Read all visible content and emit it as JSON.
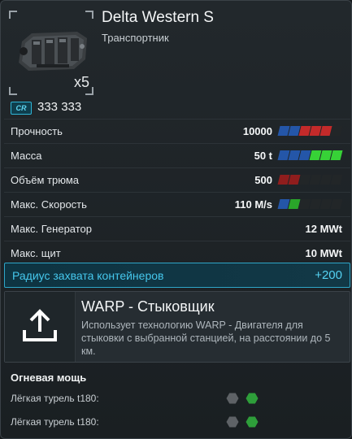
{
  "item": {
    "title": "Delta Western S",
    "subtitle": "Транспортник",
    "count": "x5",
    "ship_image_icon": "cargo-ship-icon"
  },
  "price": {
    "currency_icon_text": "CR",
    "value": "333 333"
  },
  "stats": [
    {
      "label": "Прочность",
      "value": "10000",
      "bar": [
        "#2456a8",
        "#2456a8",
        "#c32a2a",
        "#c32a2a",
        "#c32a2a",
        "#222628"
      ]
    },
    {
      "label": "Масса",
      "value": "50 t",
      "bar": [
        "#2456a8",
        "#2456a8",
        "#2456a8",
        "#37d237",
        "#37d237",
        "#37d237"
      ]
    },
    {
      "label": "Объём трюма",
      "value": "500",
      "bar": [
        "#8f1d1d",
        "#8f1d1d",
        "#222628",
        "#222628",
        "#222628",
        "#222628"
      ]
    },
    {
      "label": "Макс. Скорость",
      "value": "110 M/s",
      "bar": [
        "#2456a8",
        "#2aa52a",
        "#222628",
        "#222628",
        "#222628",
        "#222628"
      ]
    },
    {
      "label": "Макс. Генератор",
      "value": "12 MWt"
    },
    {
      "label": "Макс. щит",
      "value": "10 MWt"
    }
  ],
  "highlight": {
    "label": "Радиус захвата контейнеров",
    "value": "+200"
  },
  "warp": {
    "icon": "upload-icon",
    "title": "WARP - Стыковщик",
    "description": "Использует технологию WARP - Двигателя для стыковки с выбранной станцией, на расстоянии до 5 км."
  },
  "firepower": {
    "title": "Огневая мощь",
    "turrets": [
      {
        "label": "Лёгкая турель t180:",
        "slots": [
          "#5e6266",
          "#2e9e3a"
        ]
      },
      {
        "label": "Лёгкая турель t180:",
        "slots": [
          "#5e6266",
          "#2e9e3a"
        ]
      }
    ]
  }
}
